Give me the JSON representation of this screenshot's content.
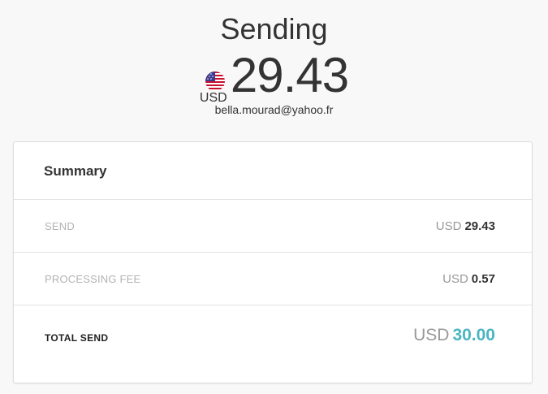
{
  "header": {
    "title": "Sending",
    "currency_code": "USD",
    "amount": "29.43",
    "recipient_email": "bella.mourad@yahoo.fr",
    "flag_icon": "us-flag-icon"
  },
  "summary": {
    "title": "Summary",
    "rows": [
      {
        "label": "SEND",
        "currency": "USD",
        "value": "29.43"
      },
      {
        "label": "PROCESSING FEE",
        "currency": "USD",
        "value": "0.57"
      }
    ],
    "total": {
      "label": "TOTAL SEND",
      "currency": "USD",
      "value": "30.00"
    }
  },
  "colors": {
    "accent": "#4ab6c1",
    "muted": "#999999",
    "text": "#333333"
  }
}
